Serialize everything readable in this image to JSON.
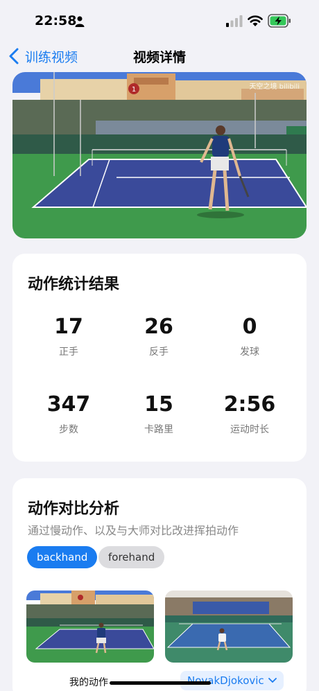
{
  "status_bar": {
    "time": "22:58"
  },
  "nav": {
    "back_label": "训练视频",
    "title": "视频详情"
  },
  "hero": {
    "watermark": "天空之境 bilibili",
    "stadium_number": "1"
  },
  "stats": {
    "title": "动作统计结果",
    "items": [
      {
        "value": "17",
        "label": "正手"
      },
      {
        "value": "26",
        "label": "反手"
      },
      {
        "value": "0",
        "label": "发球"
      },
      {
        "value": "347",
        "label": "步数"
      },
      {
        "value": "15",
        "label": "卡路里"
      },
      {
        "value": "2:56",
        "label": "运动时长"
      }
    ]
  },
  "compare": {
    "title": "动作对比分析",
    "subtitle": "通过慢动作、以及与大师对比改进挥拍动作",
    "chips": [
      "backhand",
      "forehand"
    ],
    "my_label": "我的动作",
    "pro_select": "NovakDjokovic"
  },
  "colors": {
    "accent": "#1a7cf0",
    "court_blue": "#3a4a9a",
    "court_green": "#3f9a4c"
  }
}
